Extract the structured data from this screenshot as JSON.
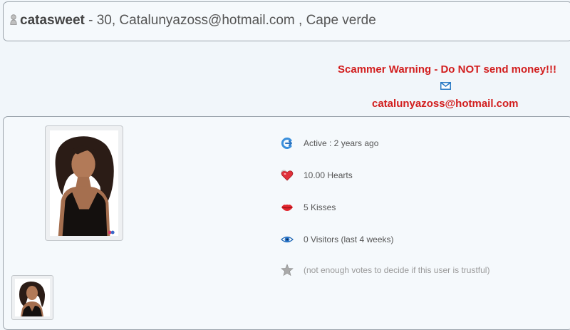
{
  "header": {
    "username": "catasweet",
    "details": " - 30, Catalunyazoss@hotmail.com , Cape verde"
  },
  "warning": {
    "title": "Scammer Warning - Do NOT send money!!!",
    "email": "catalunyazoss@hotmail.com",
    "color": "#d21d1d"
  },
  "stats": [
    {
      "icon": "active-status-icon",
      "text": "Active : 2 years ago"
    },
    {
      "icon": "hearts-icon",
      "text": "10.00 Hearts"
    },
    {
      "icon": "kisses-lips-icon",
      "text": "5 Kisses"
    },
    {
      "icon": "eye-icon",
      "text": "0 Visitors (last 4 weeks)"
    },
    {
      "icon": "star-icon",
      "text": "(not enough votes to decide if this user is trustful)"
    }
  ]
}
